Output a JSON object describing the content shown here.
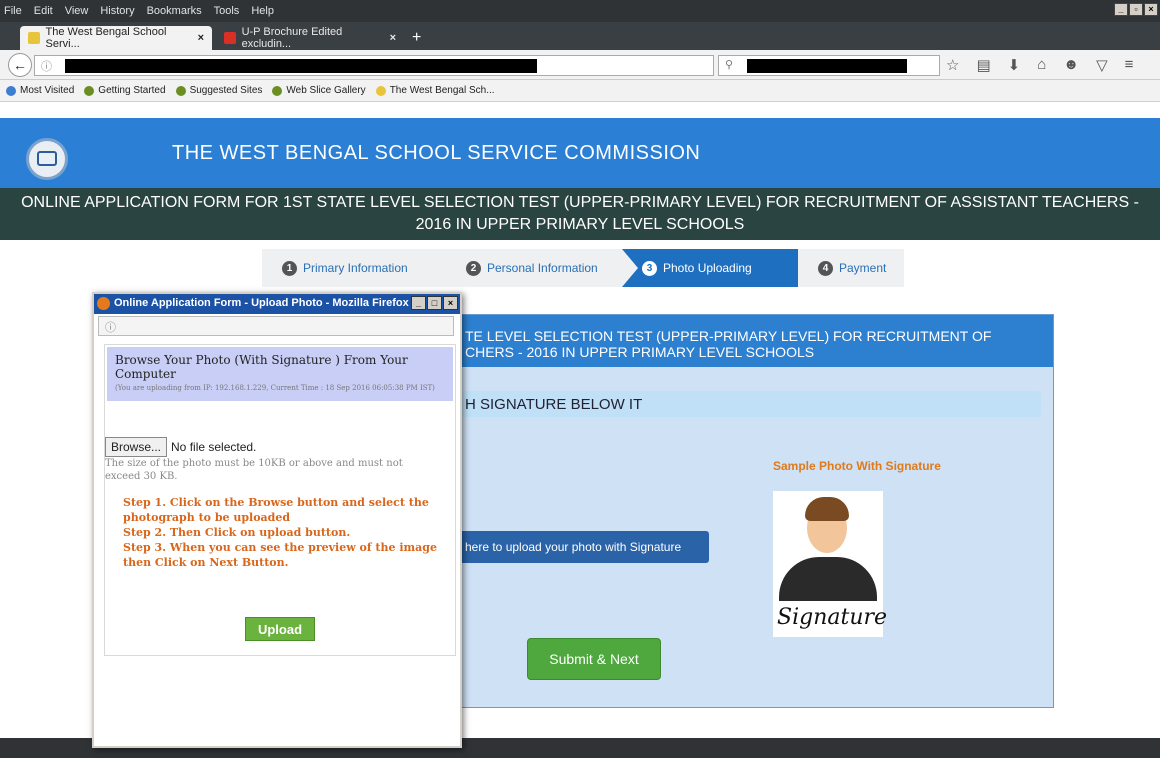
{
  "menu": [
    "File",
    "Edit",
    "View",
    "History",
    "Bookmarks",
    "Tools",
    "Help"
  ],
  "tabs": [
    {
      "label": "The West Bengal School Servi...",
      "active": true
    },
    {
      "label": "U-P Brochure Edited excludin...",
      "active": false
    }
  ],
  "new_tab_icon": "+",
  "bookmarks": [
    "Most Visited",
    "Getting Started",
    "Suggested Sites",
    "Web Slice Gallery",
    "The West Bengal Sch..."
  ],
  "site": {
    "title": "THE WEST BENGAL SCHOOL SERVICE COMMISSION",
    "banner_line1": "ONLINE APPLICATION FORM FOR 1ST STATE LEVEL SELECTION TEST (UPPER-PRIMARY LEVEL) FOR RECRUITMENT OF ASSISTANT TEACHERS -",
    "banner_line2": "2016 IN UPPER PRIMARY LEVEL SCHOOLS"
  },
  "steps": [
    {
      "num": "1",
      "label": "Primary Information"
    },
    {
      "num": "2",
      "label": "Personal Information"
    },
    {
      "num": "3",
      "label": "Photo Uploading"
    },
    {
      "num": "4",
      "label": "Payment"
    }
  ],
  "panel": {
    "head_line1": "TE LEVEL SELECTION TEST (UPPER-PRIMARY LEVEL) FOR RECRUITMENT OF",
    "head_line2": "CHERS - 2016 IN UPPER PRIMARY LEVEL SCHOOLS",
    "signature_band": "H SIGNATURE BELOW IT",
    "upload_here": "here to upload your photo with Signature",
    "sample_label": "Sample Photo With Signature",
    "signature_text": "Signature",
    "submit": "Submit & Next"
  },
  "popup": {
    "title": "Online Application Form - Upload Photo - Mozilla Firefox",
    "url_icon": "ⓘ",
    "browse_title": "Browse Your Photo (With Signature ) From Your Computer",
    "browse_sub": "(You are uploading from IP: 192.168.1.229, Current Time : 18 Sep 2016 06:05:38 PM IST)",
    "browse_button": "Browse...",
    "file_status": "No file selected.",
    "size_note": "The size of the photo must be 10KB or above and must not exceed 30 KB.",
    "step1": "Step 1. Click on the Browse button and select the photograph to be uploaded",
    "step2": "Step 2. Then Click on upload button.",
    "step3": "Step 3. When you can see the preview of the image then Click on Next Button.",
    "upload": "Upload"
  }
}
